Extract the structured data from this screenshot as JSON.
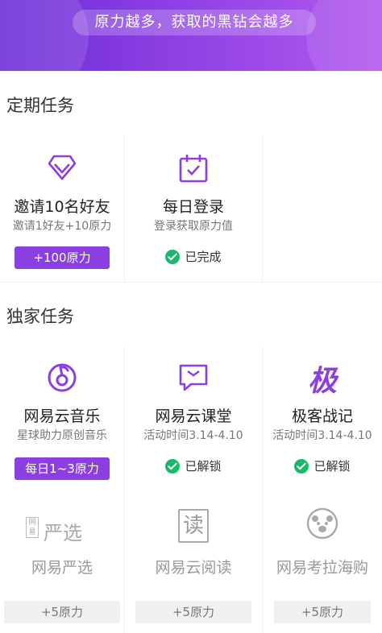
{
  "banner": {
    "text": "原力越多，获取的黑钻会越多"
  },
  "periodic": {
    "heading": "定期任务",
    "tasks": [
      {
        "title": "邀请10名好友",
        "subtitle": "邀请1好友+10原力",
        "button": "+100原力",
        "icon": "diamond-icon"
      },
      {
        "title": "每日登录",
        "subtitle": "登录获取原力值",
        "status": "已完成",
        "icon": "calendar-check-icon"
      }
    ]
  },
  "exclusive": {
    "heading": "独家任务",
    "tasks": [
      {
        "title": "网易云音乐",
        "subtitle": "星球助力原创音乐",
        "button": "每日1~3原力",
        "icon": "netease-music-icon"
      },
      {
        "title": "网易云课堂",
        "subtitle": "活动时间3.14-4.10",
        "status": "已解锁",
        "icon": "chat-book-icon"
      },
      {
        "title": "极客战记",
        "subtitle": "活动时间3.14-4.10",
        "status": "已解锁",
        "icon_text": "极"
      }
    ],
    "locked": [
      {
        "title": "网易严选",
        "button": "+5原力",
        "logo_small": "网易",
        "logo_main": "严选"
      },
      {
        "title": "网易云阅读",
        "button": "+5原力",
        "logo_text": "读"
      },
      {
        "title": "网易考拉海购",
        "button": "+5原力",
        "icon": "koala-icon"
      }
    ]
  },
  "colors": {
    "accent": "#8b3fe3",
    "success": "#19b96b"
  }
}
